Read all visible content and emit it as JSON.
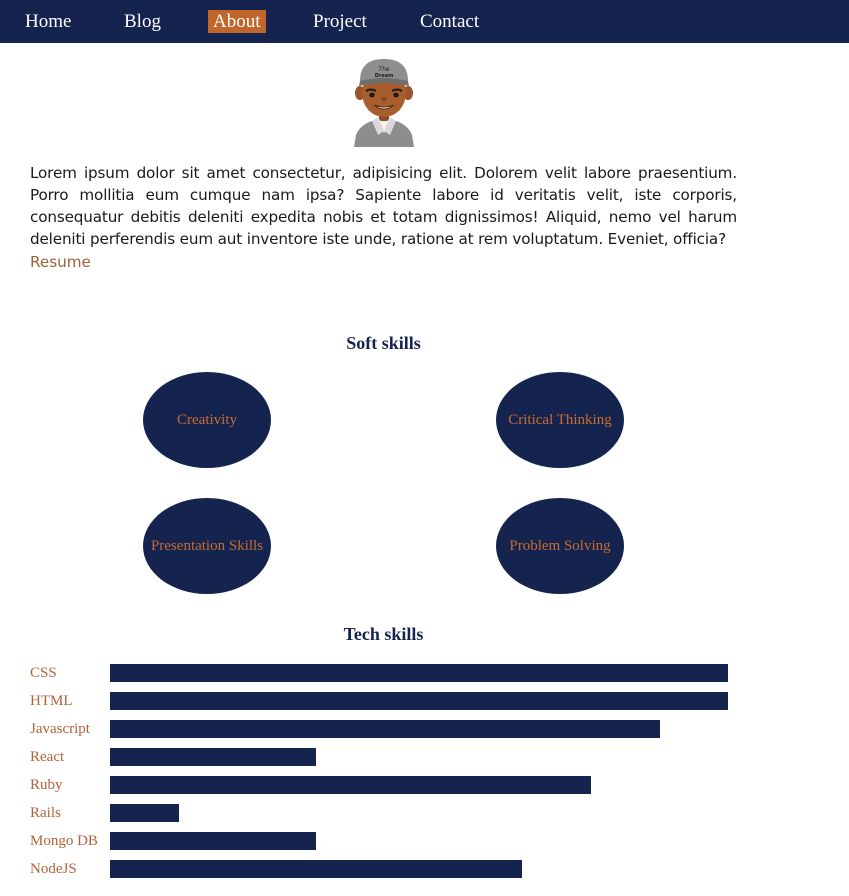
{
  "nav": {
    "items": [
      {
        "label": "Home",
        "active": false
      },
      {
        "label": "Blog",
        "active": false
      },
      {
        "label": "About",
        "active": true
      },
      {
        "label": "Project",
        "active": false
      },
      {
        "label": "Contact",
        "active": false
      }
    ]
  },
  "about": {
    "bio": "Lorem ipsum dolor sit amet consectetur, adipisicing elit. Dolorem velit labore praesentium. Porro mollitia eum cumque nam ipsa? Sapiente labore id veritatis velit, iste corporis, consequatur debitis deleniti expedita nobis et totam dignissimos! Aliquid, nemo vel harum deleniti perferendis eum aut inventore iste unde, ratione at rem voluptatum. Eveniet, officia?",
    "resume_link": "Resume"
  },
  "soft_skills": {
    "title": "Soft skills",
    "items": [
      "Creativity",
      "Critical Thinking",
      "Presentation Skills",
      "Problem Solving"
    ]
  },
  "tech_skills": {
    "title": "Tech skills",
    "items": [
      {
        "name": "CSS",
        "level": 0.9
      },
      {
        "name": "HTML",
        "level": 0.9
      },
      {
        "name": "Javascript",
        "level": 0.8
      },
      {
        "name": "React",
        "level": 0.3
      },
      {
        "name": "Ruby",
        "level": 0.7
      },
      {
        "name": "Rails",
        "level": 0.1
      },
      {
        "name": "Mongo DB",
        "level": 0.3
      },
      {
        "name": "NodeJS",
        "level": 0.6
      }
    ]
  },
  "colors": {
    "navy": "#15244f",
    "accent": "#c0662b",
    "link": "#a0623a"
  }
}
